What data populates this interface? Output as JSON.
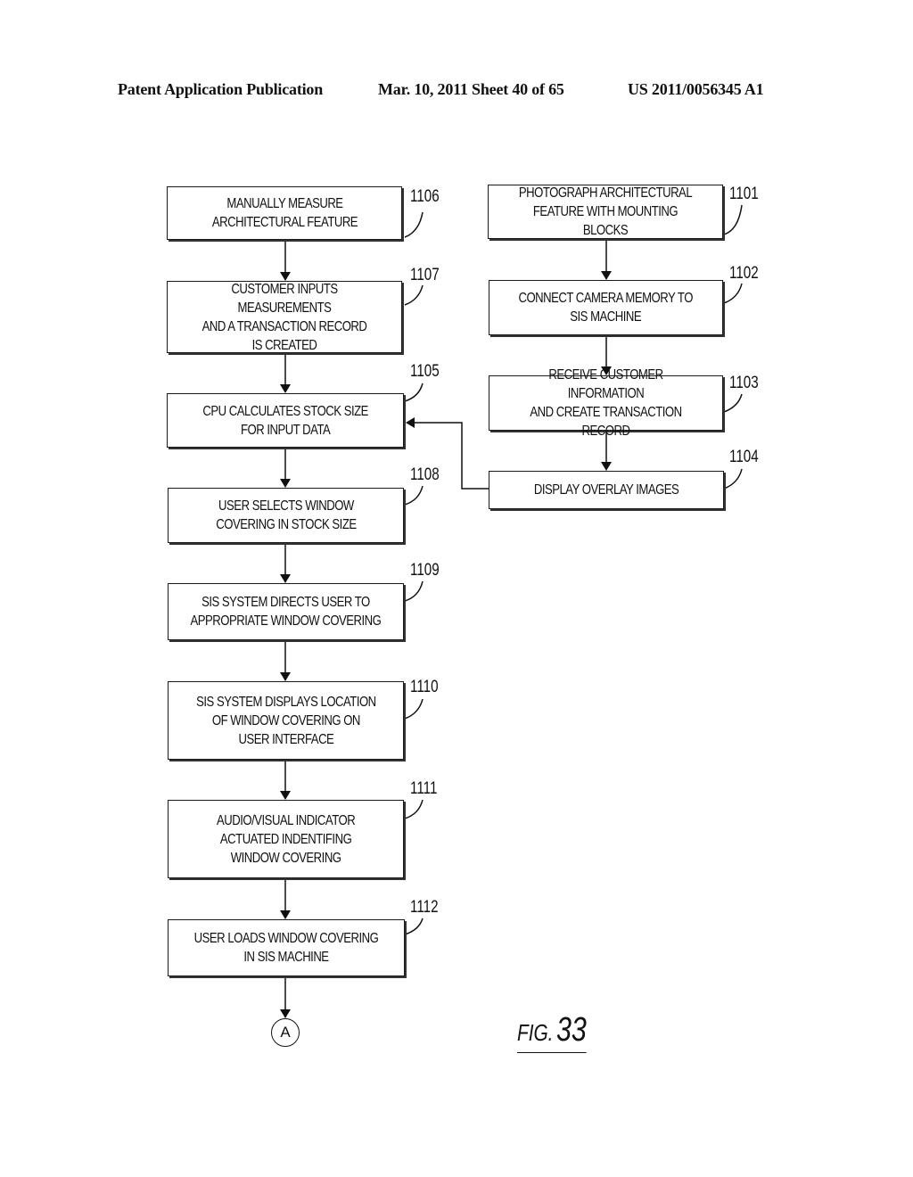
{
  "header": {
    "publication": "Patent Application Publication",
    "date_sheet": "Mar. 10, 2011  Sheet 40 of 65",
    "patent_number": "US 2011/0056345 A1"
  },
  "left_column": [
    {
      "ref": "1106",
      "text": "MANUALLY MEASURE\nARCHITECTURAL FEATURE"
    },
    {
      "ref": "1107",
      "text": "CUSTOMER INPUTS MEASUREMENTS\nAND A TRANSACTION RECORD\nIS  CREATED"
    },
    {
      "ref": "1105",
      "text": "CPU CALCULATES STOCK SIZE\nFOR INPUT DATA"
    },
    {
      "ref": "1108",
      "text": "USER SELECTS WINDOW\nCOVERING IN STOCK SIZE"
    },
    {
      "ref": "1109",
      "text": "SIS SYSTEM DIRECTS USER TO\nAPPROPRIATE WINDOW COVERING"
    },
    {
      "ref": "1110",
      "text": "SIS SYSTEM DISPLAYS LOCATION\nOF WINDOW COVERING ON\nUSER INTERFACE"
    },
    {
      "ref": "1111",
      "text": "AUDIO/VISUAL INDICATOR\nACTUATED INDENTIFING\nWINDOW COVERING"
    },
    {
      "ref": "1112",
      "text": "USER LOADS WINDOW COVERING\nIN SIS MACHINE"
    }
  ],
  "right_column": [
    {
      "ref": "1101",
      "text": "PHOTOGRAPH ARCHITECTURAL\nFEATURE WITH MOUNTING BLOCKS"
    },
    {
      "ref": "1102",
      "text": "CONNECT CAMERA MEMORY TO\nSIS MACHINE"
    },
    {
      "ref": "1103",
      "text": "RECEIVE CUSTOMER INFORMATION\nAND CREATE TRANSACTION RECORD"
    },
    {
      "ref": "1104",
      "text": "DISPLAY OVERLAY IMAGES"
    }
  ],
  "connector_label": "A",
  "figure": {
    "prefix": "FIG.",
    "number": "33"
  }
}
